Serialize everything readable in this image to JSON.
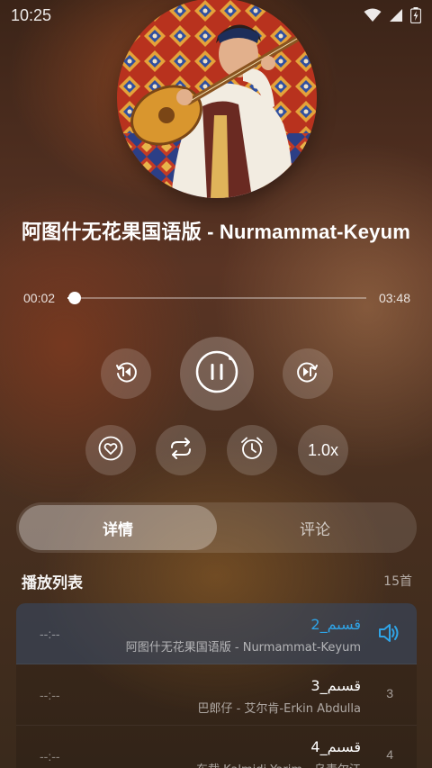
{
  "status_bar": {
    "time": "10:25",
    "icons": [
      "wifi-icon",
      "signal-icon",
      "battery-icon"
    ]
  },
  "player": {
    "cover_icon": "album-cover",
    "title": "阿图什无花果国语版 - Nurmammat-Keyum",
    "time_current": "00:02",
    "time_total": "03:48",
    "progress_fraction": 0.01,
    "speed": "1.0x",
    "controls": [
      "skip-back-icon",
      "pause-icon",
      "skip-forward-icon"
    ],
    "actions": [
      "heart-icon",
      "repeat-icon",
      "alarm-clock-icon"
    ]
  },
  "tabs": {
    "details": "详情",
    "comments": "评论"
  },
  "playlist": {
    "title": "播放列表",
    "count": "15首",
    "items": [
      {
        "duration": "--:--",
        "name": "قسىم_2",
        "artist": "阿图什无花果国语版 - Nurmammat-Keyum",
        "index": "",
        "playing": true
      },
      {
        "duration": "--:--",
        "name": "قسىم_3",
        "artist": "巴郎仔 - 艾尔肯-Erkin Abdulla",
        "index": "3",
        "playing": false
      },
      {
        "duration": "--:--",
        "name": "قسىم_4",
        "artist": "东载 Kalmidi Yarim - 乌麦尔江",
        "index": "4",
        "playing": false
      }
    ]
  },
  "colors": {
    "accent": "#2fa4e7",
    "current_row_bg": "#3c506e"
  }
}
